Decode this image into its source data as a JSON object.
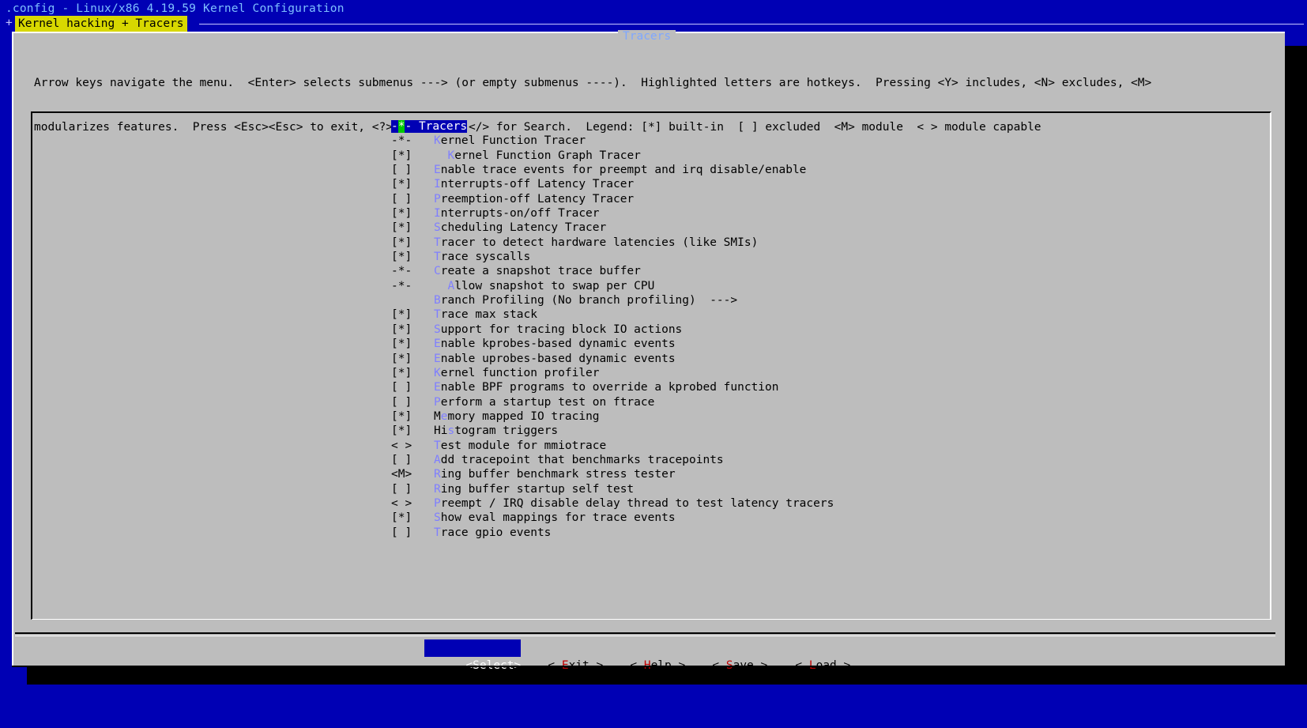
{
  "window": {
    "title": ".config - Linux/x86 4.19.59 Kernel Configuration",
    "crumb_plus": "+",
    "breadcrumb": "Kernel hacking + Tracers"
  },
  "dialog": {
    "title": "Tracers",
    "help_line1": "Arrow keys navigate the menu.  <Enter> selects submenus ---> (or empty submenus ----).  Highlighted letters are hotkeys.  Pressing <Y> includes, <N> excludes, <M>",
    "help_line2": "modularizes features.  Press <Esc><Esc> to exit, <?> for Help, </> for Search.  Legend: [*] built-in  [ ] excluded  <M> module  < > module capable"
  },
  "menu": {
    "items": [
      {
        "box": "-*-",
        "hot": "",
        "rest": "Tracers",
        "indent": "",
        "selected": true
      },
      {
        "box": "-*-",
        "hot": "K",
        "rest": "ernel Function Tracer",
        "indent": ""
      },
      {
        "box": "[*]",
        "hot": "K",
        "rest": "ernel Function Graph Tracer",
        "indent": "  "
      },
      {
        "box": "[ ]",
        "hot": "E",
        "rest": "nable trace events for preempt and irq disable/enable",
        "indent": ""
      },
      {
        "box": "[*]",
        "hot": "I",
        "rest": "nterrupts-off Latency Tracer",
        "indent": ""
      },
      {
        "box": "[ ]",
        "hot": "P",
        "rest": "reemption-off Latency Tracer",
        "indent": ""
      },
      {
        "box": "[*]",
        "hot": "I",
        "rest": "nterrupts-on/off Tracer",
        "indent": ""
      },
      {
        "box": "[*]",
        "hot": "S",
        "rest": "cheduling Latency Tracer",
        "indent": ""
      },
      {
        "box": "[*]",
        "hot": "T",
        "rest": "racer to detect hardware latencies (like SMIs)",
        "indent": ""
      },
      {
        "box": "[*]",
        "hot": "T",
        "rest": "race syscalls",
        "indent": ""
      },
      {
        "box": "-*-",
        "hot": "C",
        "rest": "reate a snapshot trace buffer",
        "indent": ""
      },
      {
        "box": "-*-",
        "hot": "A",
        "rest": "llow snapshot to swap per CPU",
        "indent": "  "
      },
      {
        "box": "",
        "hot": "B",
        "rest": "ranch Profiling (No branch profiling)  --->",
        "indent": ""
      },
      {
        "box": "[*]",
        "hot": "T",
        "rest": "race max stack",
        "indent": ""
      },
      {
        "box": "[*]",
        "hot": "S",
        "rest": "upport for tracing block IO actions",
        "indent": ""
      },
      {
        "box": "[*]",
        "hot": "E",
        "rest": "nable kprobes-based dynamic events",
        "indent": ""
      },
      {
        "box": "[*]",
        "hot": "E",
        "rest": "nable uprobes-based dynamic events",
        "indent": ""
      },
      {
        "box": "[*]",
        "hot": "K",
        "rest": "ernel function profiler",
        "indent": ""
      },
      {
        "box": "[ ]",
        "hot": "E",
        "rest": "nable BPF programs to override a kprobed function",
        "indent": ""
      },
      {
        "box": "[ ]",
        "hot": "P",
        "rest": "erform a startup test on ftrace",
        "indent": ""
      },
      {
        "box": "[*]",
        "pre": "M",
        "hot": "e",
        "rest": "mory mapped IO tracing",
        "indent": ""
      },
      {
        "box": "[*]",
        "pre": "Hi",
        "hot": "s",
        "rest": "togram triggers",
        "indent": ""
      },
      {
        "box": "< >",
        "hot": "T",
        "rest": "est module for mmiotrace",
        "indent": ""
      },
      {
        "box": "[ ]",
        "hot": "A",
        "rest": "dd tracepoint that benchmarks tracepoints",
        "indent": ""
      },
      {
        "box": "<M>",
        "hot": "R",
        "rest": "ing buffer benchmark stress tester",
        "indent": ""
      },
      {
        "box": "[ ]",
        "hot": "R",
        "rest": "ing buffer startup self test",
        "indent": ""
      },
      {
        "box": "< >",
        "hot": "P",
        "rest": "reempt / IRQ disable delay thread to test latency tracers",
        "indent": ""
      },
      {
        "box": "[*]",
        "hot": "S",
        "rest": "how eval mappings for trace events",
        "indent": ""
      },
      {
        "box": "[ ]",
        "hot": "T",
        "rest": "race gpio events",
        "indent": ""
      }
    ]
  },
  "buttons": {
    "select": {
      "pre": "<",
      "hot": "S",
      "rest": "elect>"
    },
    "exit": {
      "pre": "< ",
      "hot": "E",
      "rest": "xit >"
    },
    "help": {
      "pre": "< ",
      "hot": "H",
      "rest": "elp >"
    },
    "save": {
      "pre": "< ",
      "hot": "S",
      "rest": "ave >"
    },
    "load": {
      "pre": "< ",
      "hot": "L",
      "rest": "oad >"
    }
  },
  "colors": {
    "background": "#0000b4",
    "dialog": "#bdbdbd",
    "highlight": "#0000b4",
    "hotkey": "#7f7fff",
    "button_hotkey": "#c00000",
    "breadcrumb_bg": "#d8d800",
    "cursor": "#00c800"
  }
}
